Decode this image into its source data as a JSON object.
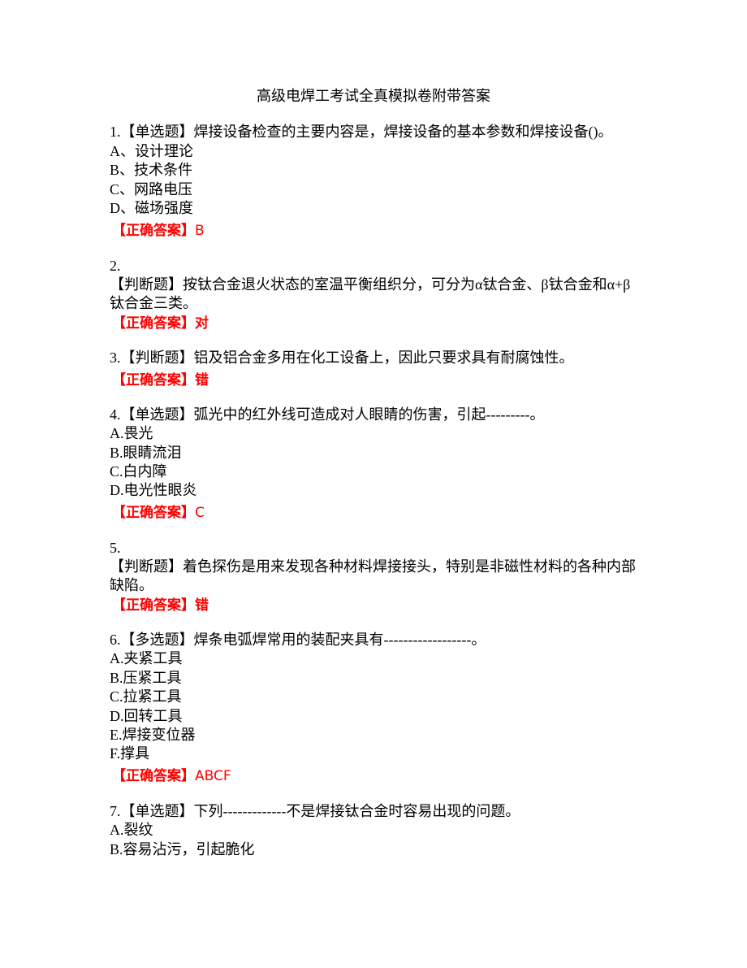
{
  "title": "高级电焊工考试全真模拟卷附带答案",
  "answer_label": "【正确答案】",
  "questions": [
    {
      "stem": "1.【单选题】焊接设备检查的主要内容是，焊接设备的基本参数和焊接设备()。",
      "options": [
        "A、设计理论",
        "B、技术条件",
        "C、网路电压",
        "D、磁场强度"
      ],
      "answer": "B"
    },
    {
      "number": "2.",
      "stem_line1": "【判断题】按钛合金退火状态的室温平衡组织分，可分为α钛合金、β钛合金和α+β",
      "stem_line2": "钛合金三类。",
      "answer": "对"
    },
    {
      "stem": "3.【判断题】铝及铝合金多用在化工设备上，因此只要求具有耐腐蚀性。",
      "answer": "错"
    },
    {
      "stem": "4.【单选题】弧光中的红外线可造成对人眼睛的伤害，引起---------。",
      "options": [
        "A.畏光",
        "B.眼睛流泪",
        "C.白内障",
        "D.电光性眼炎"
      ],
      "answer": "C"
    },
    {
      "number": "5.",
      "stem_line1": "【判断题】着色探伤是用来发现各种材料焊接接头，特别是非磁性材料的各种内部",
      "stem_line2": "缺陷。",
      "answer": "错"
    },
    {
      "stem": "6.【多选题】焊条电弧焊常用的装配夹具有------------------。",
      "options": [
        "A.夹紧工具",
        "B.压紧工具",
        "C.拉紧工具",
        "D.回转工具",
        "E.焊接变位器",
        "F.撑具"
      ],
      "answer": "ABCF"
    },
    {
      "stem": "7.【单选题】下列-------------不是焊接钛合金时容易出现的问题。",
      "options": [
        "A.裂纹",
        "B.容易沾污，引起脆化"
      ]
    }
  ]
}
